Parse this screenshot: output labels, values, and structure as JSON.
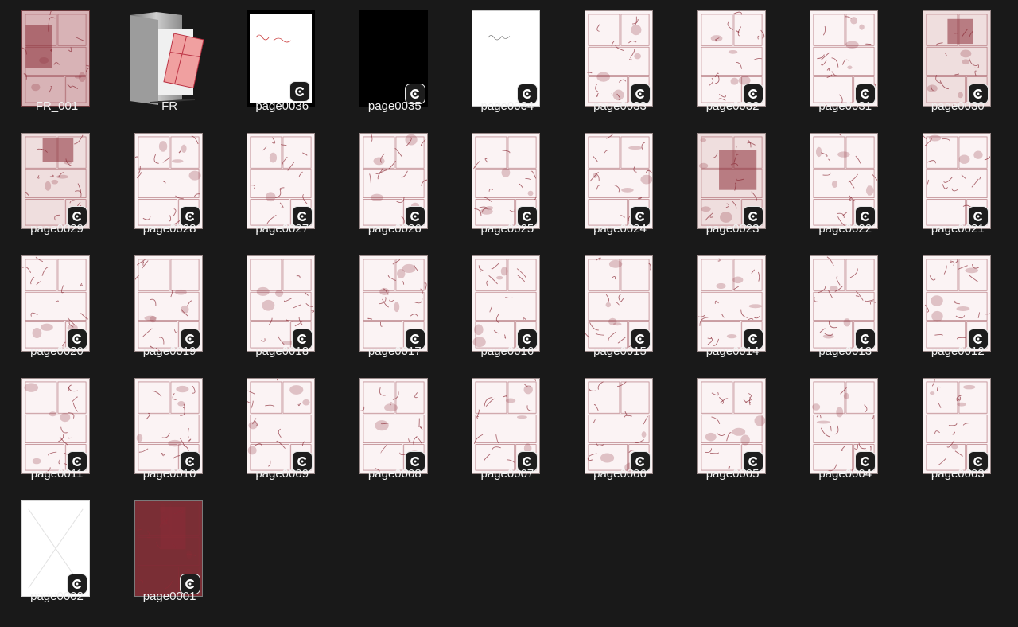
{
  "theme": {
    "background": "#191919",
    "label_color": "#f0f0f0",
    "manga_ink": "#8a2b36",
    "badge_color": "#1d1d1d"
  },
  "items": [
    {
      "label": "FR_001",
      "kind": "cover",
      "icon": "cover-thumbnail"
    },
    {
      "label": "FR",
      "kind": "folder",
      "icon": "folder-icon"
    },
    {
      "label": "page0036",
      "kind": "frame",
      "icon": "clip-studio-icon"
    },
    {
      "label": "page0035",
      "kind": "black",
      "icon": "clip-studio-icon"
    },
    {
      "label": "page0034",
      "kind": "white",
      "icon": "clip-studio-icon"
    },
    {
      "label": "page0033",
      "kind": "art",
      "icon": "clip-studio-icon"
    },
    {
      "label": "page0032",
      "kind": "art",
      "icon": "clip-studio-icon"
    },
    {
      "label": "page0031",
      "kind": "art",
      "icon": "clip-studio-icon"
    },
    {
      "label": "page0030",
      "kind": "dark",
      "icon": "clip-studio-icon"
    },
    {
      "label": "page0029",
      "kind": "dark",
      "icon": "clip-studio-icon"
    },
    {
      "label": "page0028",
      "kind": "art",
      "icon": "clip-studio-icon"
    },
    {
      "label": "page0027",
      "kind": "art",
      "icon": "clip-studio-icon"
    },
    {
      "label": "page0026",
      "kind": "art",
      "icon": "clip-studio-icon"
    },
    {
      "label": "page0025",
      "kind": "art",
      "icon": "clip-studio-icon"
    },
    {
      "label": "page0024",
      "kind": "art",
      "icon": "clip-studio-icon"
    },
    {
      "label": "page0023",
      "kind": "dark",
      "icon": "clip-studio-icon"
    },
    {
      "label": "page0022",
      "kind": "art",
      "icon": "clip-studio-icon"
    },
    {
      "label": "page0021",
      "kind": "art",
      "icon": "clip-studio-icon"
    },
    {
      "label": "page0020",
      "kind": "art",
      "icon": "clip-studio-icon"
    },
    {
      "label": "page0019",
      "kind": "art",
      "icon": "clip-studio-icon"
    },
    {
      "label": "page0018",
      "kind": "art",
      "icon": "clip-studio-icon"
    },
    {
      "label": "page0017",
      "kind": "art",
      "icon": "clip-studio-icon"
    },
    {
      "label": "page0016",
      "kind": "art",
      "icon": "clip-studio-icon"
    },
    {
      "label": "page0015",
      "kind": "art",
      "icon": "clip-studio-icon"
    },
    {
      "label": "page0014",
      "kind": "art",
      "icon": "clip-studio-icon"
    },
    {
      "label": "page0013",
      "kind": "art",
      "icon": "clip-studio-icon"
    },
    {
      "label": "page0012",
      "kind": "art",
      "icon": "clip-studio-icon"
    },
    {
      "label": "page0011",
      "kind": "art",
      "icon": "clip-studio-icon"
    },
    {
      "label": "page0010",
      "kind": "art",
      "icon": "clip-studio-icon"
    },
    {
      "label": "page0009",
      "kind": "art",
      "icon": "clip-studio-icon"
    },
    {
      "label": "page0008",
      "kind": "art",
      "icon": "clip-studio-icon"
    },
    {
      "label": "page0007",
      "kind": "art",
      "icon": "clip-studio-icon"
    },
    {
      "label": "page0006",
      "kind": "art",
      "icon": "clip-studio-icon"
    },
    {
      "label": "page0005",
      "kind": "art",
      "icon": "clip-studio-icon"
    },
    {
      "label": "page0004",
      "kind": "art",
      "icon": "clip-studio-icon"
    },
    {
      "label": "page0003",
      "kind": "art",
      "icon": "clip-studio-icon"
    },
    {
      "label": "page0002",
      "kind": "cross",
      "icon": "clip-studio-icon"
    },
    {
      "label": "page0001",
      "kind": "cover2",
      "icon": "clip-studio-icon"
    }
  ]
}
